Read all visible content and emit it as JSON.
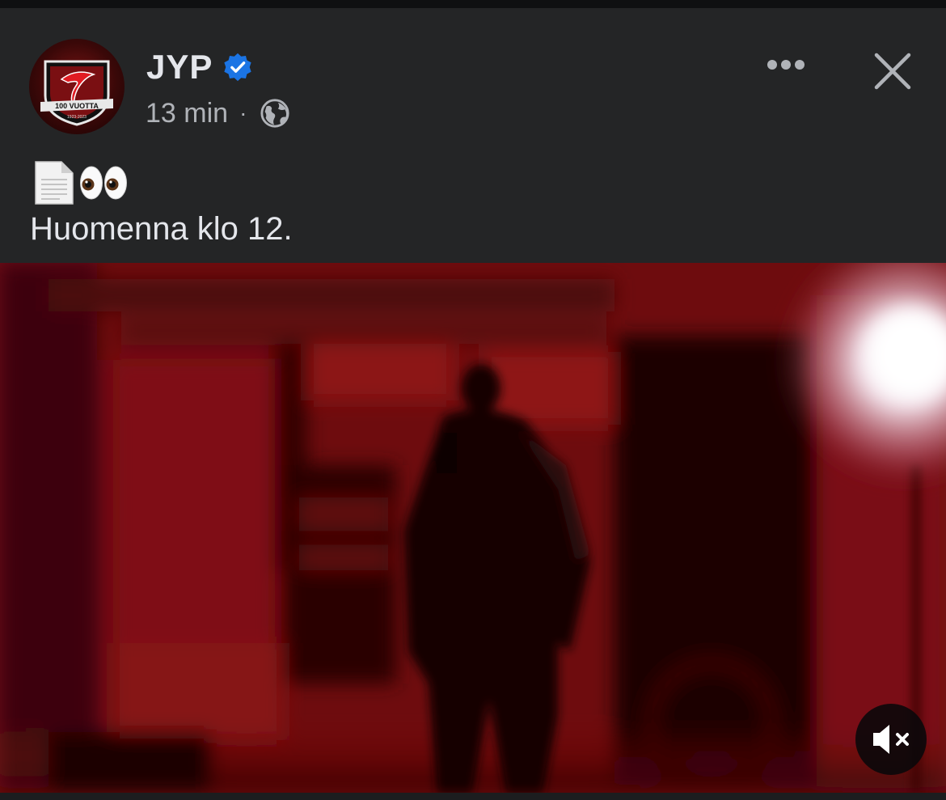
{
  "post": {
    "author": "JYP",
    "time": "13 min",
    "separator": "·",
    "avatar_badge_text": "100 VUOTTA",
    "avatar_years": "1923-2023",
    "emojis": [
      "page-icon",
      "eyes-icon"
    ],
    "text": "Huomenna klo 12."
  },
  "icons": {
    "verified": "verified-badge-icon",
    "privacy": "globe-icon",
    "more": "more-options-icon",
    "close": "close-icon",
    "sound": "mute-icon"
  },
  "colors": {
    "background": "#242526",
    "text_primary": "#e4e6eb",
    "text_secondary": "#b0b3b8",
    "verified": "#1b74e4",
    "brand_red": "#c8102e"
  }
}
